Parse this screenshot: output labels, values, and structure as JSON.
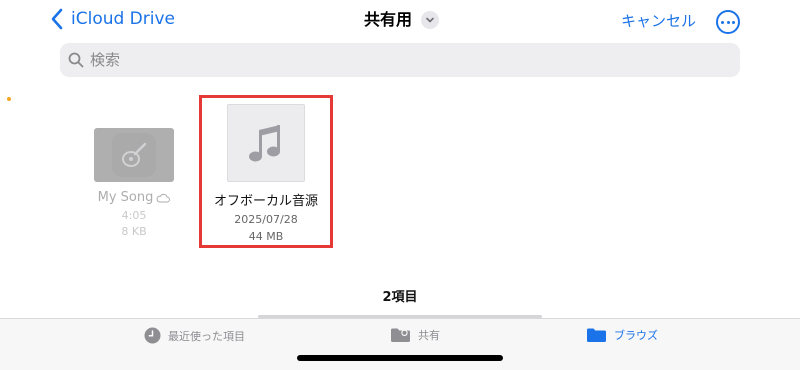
{
  "nav": {
    "back_label": "iCloud Drive",
    "title": "共有用",
    "cancel_label": "キャンセル"
  },
  "search": {
    "placeholder": "検索"
  },
  "files": [
    {
      "name": "My Song",
      "line1": "4:05",
      "line2": "8 KB",
      "icon": "garageband-icon",
      "status_icon": "cloud-icon",
      "dimmed": true
    },
    {
      "name": "オフボーカル音源",
      "line1": "2025/07/28",
      "line2": "44 MB",
      "icon": "music-note-icon",
      "selected": true,
      "highlight_color": "#e53935"
    }
  ],
  "item_count": "2項目",
  "tabs": [
    {
      "label": "最近使った項目",
      "icon": "clock-icon"
    },
    {
      "label": "共有",
      "icon": "shared-folder-icon"
    },
    {
      "label": "ブラウズ",
      "icon": "folder-icon",
      "active": true
    }
  ],
  "colors": {
    "accent": "#1a73e8",
    "selection_outline": "#e53935"
  }
}
